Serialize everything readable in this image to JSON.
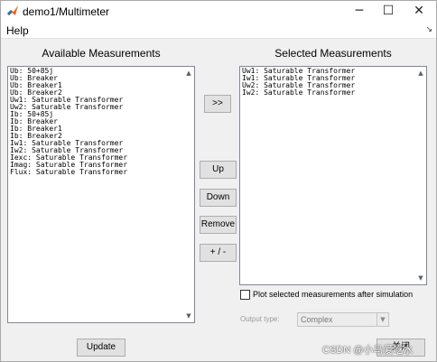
{
  "window": {
    "title": "demo1/Multimeter",
    "icon": "matlab-logo-icon",
    "controls": {
      "minimize": "─",
      "maximize": "☐",
      "close": "✕"
    }
  },
  "menu": {
    "help": "Help",
    "overflow_arrow": "↘"
  },
  "available": {
    "label": "Available Measurements",
    "items": [
      "Ub: 50+85j",
      "Ub: Breaker",
      "Ub: Breaker1",
      "Ub: Breaker2",
      "Uw1: Saturable Transformer",
      "Uw2: Saturable Transformer",
      "Ib: 50+85j",
      "Ib: Breaker",
      "Ib: Breaker1",
      "Ib: Breaker2",
      "Iw1: Saturable Transformer",
      "Iw2: Saturable Transformer",
      "Iexc: Saturable Transformer",
      "Imag: Saturable Transformer",
      "Flux: Saturable Transformer"
    ]
  },
  "selected": {
    "label": "Selected Measurements",
    "items": [
      "Uw1: Saturable Transformer",
      "Iw1: Saturable Transformer",
      "Uw2: Saturable Transformer",
      "Iw2: Saturable Transformer"
    ]
  },
  "buttons": {
    "add": ">>",
    "up": "Up",
    "down": "Down",
    "remove": "Remove",
    "sign": "+ / -",
    "update": "Update",
    "close": "关闭"
  },
  "plot_checkbox": {
    "label": "Plot selected measurements after simulation",
    "checked": false
  },
  "output_type": {
    "label": "Output type:",
    "value": "Complex"
  },
  "watermark": "CSDN @小马爱吃水"
}
